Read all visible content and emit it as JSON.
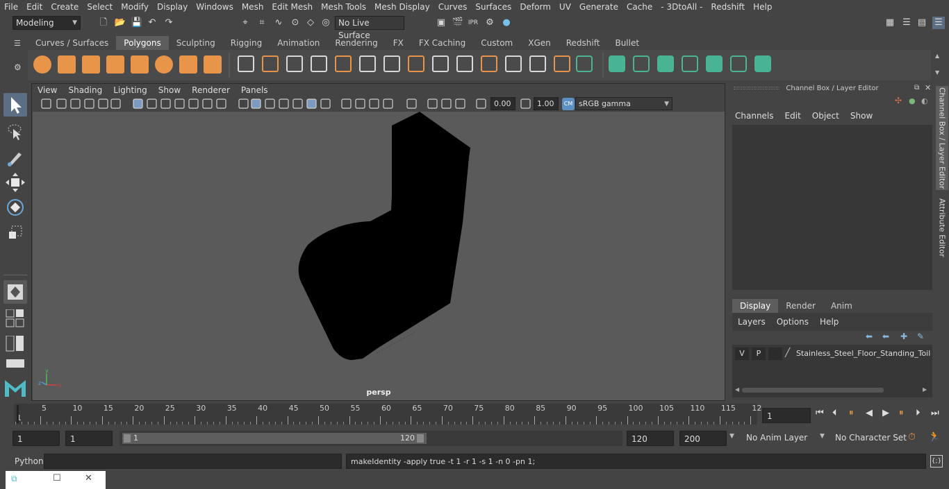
{
  "menubar": [
    "File",
    "Edit",
    "Create",
    "Select",
    "Modify",
    "Display",
    "Windows",
    "Mesh",
    "Edit Mesh",
    "Mesh Tools",
    "Mesh Display",
    "Curves",
    "Surfaces",
    "Deform",
    "UV",
    "Generate",
    "Cache",
    "- 3DtoAll -",
    "Redshift",
    "Help"
  ],
  "status": {
    "mode": "Modeling",
    "live_surface": "No Live Surface"
  },
  "shelf_tabs": [
    "Curves / Surfaces",
    "Polygons",
    "Sculpting",
    "Rigging",
    "Animation",
    "Rendering",
    "FX",
    "FX Caching",
    "Custom",
    "XGen",
    "Redshift",
    "Bullet"
  ],
  "shelf_active": "Polygons",
  "viewport": {
    "menu": [
      "View",
      "Shading",
      "Lighting",
      "Show",
      "Renderer",
      "Panels"
    ],
    "exposure": "0.00",
    "gamma": "1.00",
    "color_space": "sRGB gamma",
    "camera": "persp"
  },
  "channel_box": {
    "title": "Channel Box / Layer Editor",
    "menu": [
      "Channels",
      "Edit",
      "Object",
      "Show"
    ],
    "layer_tabs": [
      "Display",
      "Render",
      "Anim"
    ],
    "layer_active": "Display",
    "layer_menu": [
      "Layers",
      "Options",
      "Help"
    ],
    "layer": {
      "v": "V",
      "p": "P",
      "name": "Stainless_Steel_Floor_Standing_Toilet"
    }
  },
  "side_tabs": [
    "Channel Box / Layer Editor",
    "Attribute Editor"
  ],
  "timeline": {
    "start_mark": "1",
    "ticks": [
      "5",
      "10",
      "15",
      "20",
      "25",
      "30",
      "35",
      "40",
      "45",
      "50",
      "55",
      "60",
      "65",
      "70",
      "75",
      "80",
      "85",
      "90",
      "95",
      "100",
      "105",
      "110",
      "115",
      "12"
    ],
    "current_frame": "1"
  },
  "range": {
    "start": "1",
    "anim_start": "1",
    "slider_start": "1",
    "slider_end": "120",
    "end": "120",
    "anim_end": "200",
    "anim_layer": "No Anim Layer",
    "char_set": "No Character Set"
  },
  "cmd": {
    "lang": "Python",
    "output": "makeIdentity -apply true -t 1 -r 1 -s 1 -n 0 -pn 1;"
  },
  "colors": {
    "accent": "#5c6e83",
    "shelf_orange": "#e8954a",
    "shelf_green": "#49b494"
  }
}
